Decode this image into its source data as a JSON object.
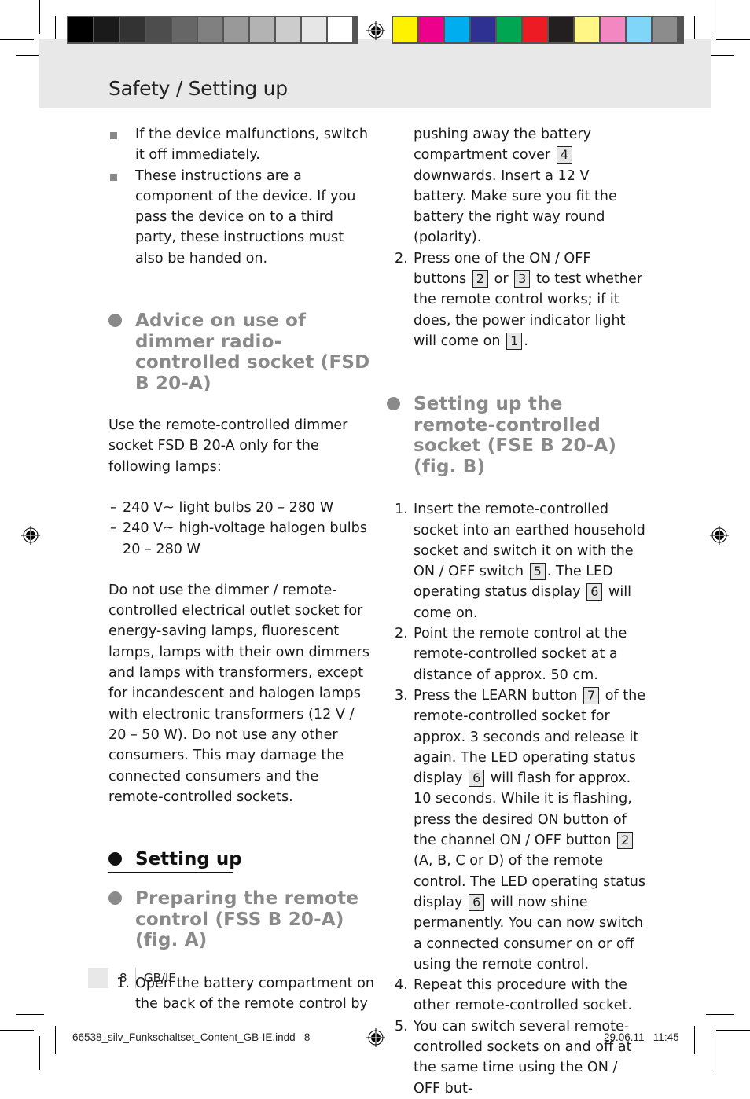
{
  "header": {
    "title": "Safety / Setting up"
  },
  "colorbar": {
    "grays": [
      "#000000",
      "#1a1a1a",
      "#333333",
      "#4d4d4d",
      "#666666",
      "#808080",
      "#999999",
      "#b3b3b3",
      "#cccccc",
      "#e6e6e6",
      "#ffffff"
    ],
    "colors": [
      "#fff200",
      "#ec008c",
      "#00aeef",
      "#2e3192",
      "#00a651",
      "#ed1c24",
      "#231f20",
      "#fff685",
      "#f287c2",
      "#7fd6f8",
      "#8c8c8c"
    ]
  },
  "left": {
    "bullets": [
      "If the device malfunctions, switch it off immediately.",
      "These instructions are a component of the device. If you pass the device on to a third party, these instructions must also be handed on."
    ],
    "advice_heading": "Advice on use of dimmer radio-controlled socket (FSD B 20-A)",
    "advice_intro": "Use the remote-controlled dimmer socket FSD B 20-A only for the following lamps:",
    "lamp_list": [
      "240 V~ light bulbs 20 – 280 W",
      "240 V~ high-voltage halogen bulbs 20 – 280 W"
    ],
    "warning_paragraph": "Do not use the dimmer / remote-controlled electrical outlet socket for energy-saving lamps, fluorescent lamps, lamps with their own dimmers and lamps with transformers, except for incandescent and halogen lamps with electronic transformers (12 V / 20 – 50 W). Do not use any other consumers. This may damage the connected consumers and the remote-controlled sockets.",
    "setting_up_heading": "Setting up",
    "preparing_heading": "Preparing the remote control (FSS B 20-A) (fig. A)",
    "step1_num": "1.",
    "step1_text": "Open the battery compartment on the back of the remote control by"
  },
  "right": {
    "cont_a": "pushing away the battery compartment cover",
    "ref_4": "4",
    "cont_b": "downwards. Insert a 12 V battery. Make sure you fit the battery the right way round (polarity).",
    "step2_num": "2.",
    "step2_a": "Press one of the ON / OFF buttons",
    "ref_2": "2",
    "step2_or": "or",
    "ref_3": "3",
    "step2_b": "to test whether the remote control works; if it does, the power indicator light will come on",
    "ref_1": "1",
    "socket_heading": "Setting up the remote-controlled socket (FSE B 20-A) (fig. B)",
    "steps": [
      {
        "num": "1.",
        "a": "Insert the remote-controlled socket into an earthed household socket and switch it on with the ON / OFF switch",
        "ref1": "5",
        "b": ". The LED operating status display",
        "ref2": "6",
        "c": "will come on."
      },
      {
        "num": "2.",
        "text": "Point the remote control at the remote-controlled socket at a distance of approx. 50 cm."
      },
      {
        "num": "3.",
        "a": "Press the LEARN button",
        "ref1": "7",
        "b": "of the remote-controlled socket for approx. 3 seconds and release it again. The LED operating status display",
        "ref2": "6",
        "c": "will flash for approx. 10 seconds. While it is flashing, press the desired ON button of the channel ON / OFF button",
        "ref3": "2",
        "d": "(A, B, C or D) of the remote control. The LED operating status display",
        "ref4": "6",
        "e": "will now shine permanently. You can now switch a connected consumer on or off using the remote control."
      },
      {
        "num": "4.",
        "text": "Repeat this procedure with the other remote-controlled socket."
      },
      {
        "num": "5.",
        "text": "You can switch several remote-controlled sockets on and off at the same time using the ON / OFF but-"
      }
    ]
  },
  "footer": {
    "page_number": "8",
    "language": "GB/IE",
    "slug_file": "66538_silv_Funkschaltset_Content_GB-IE.indd   8",
    "slug_date": "29.06.11   11:45"
  }
}
